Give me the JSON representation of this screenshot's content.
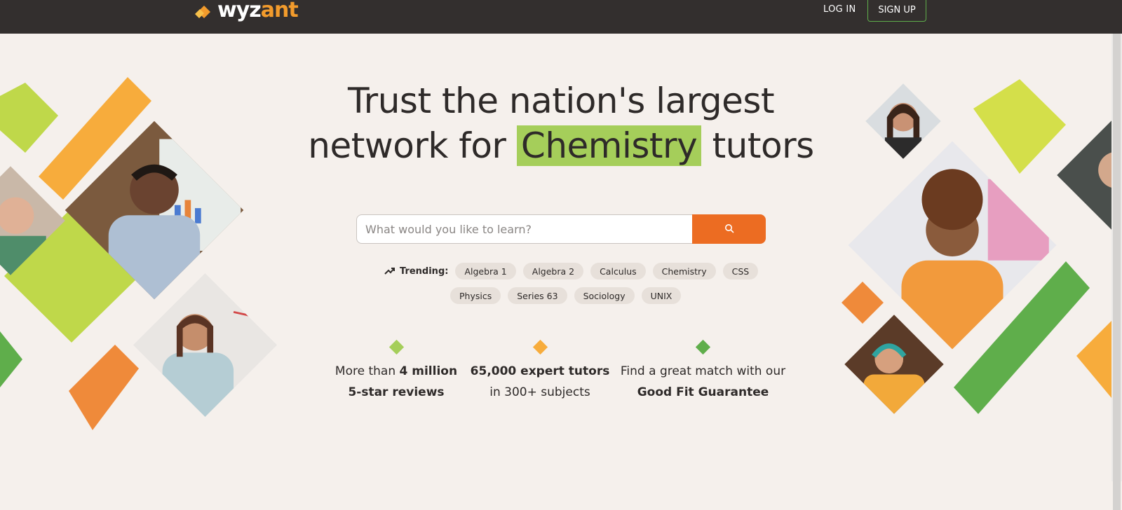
{
  "colors": {
    "nav_bg": "#332f2e",
    "page_bg": "#f5f0ec",
    "accent_orange": "#ec6c22",
    "lime": "#bfd84a",
    "green": "#5fae4b",
    "highlight": "#a5ce5a"
  },
  "nav": {
    "logo_prefix": "wyz",
    "logo_suffix": "ant",
    "login_label": "LOG IN",
    "signup_label": "SIGN UP"
  },
  "hero": {
    "line1": "Trust the nation's largest",
    "line2_pre": "network for",
    "line2_highlight": "Chemistry",
    "line2_post": "tutors"
  },
  "search": {
    "placeholder": "What would you like to learn?",
    "button_icon": "search-icon"
  },
  "trending": {
    "label": "Trending:",
    "icon": "trending-up-icon",
    "row1": [
      "Algebra 1",
      "Algebra 2",
      "Calculus",
      "Chemistry",
      "CSS"
    ],
    "row2": [
      "Physics",
      "Series 63",
      "Sociology",
      "UNIX"
    ]
  },
  "stats": [
    {
      "line1_pre": "More than",
      "line1_bold": "4 million",
      "line2_bold": "5-star reviews",
      "line2": ""
    },
    {
      "line1_pre": "",
      "line1_bold": "65,000 expert tutors",
      "line2_bold": "",
      "line2": "in 300+ subjects"
    },
    {
      "line1_pre": "Find a great match with our",
      "line1_bold": "",
      "line2_bold": "Good Fit Guarantee",
      "line2": ""
    }
  ]
}
